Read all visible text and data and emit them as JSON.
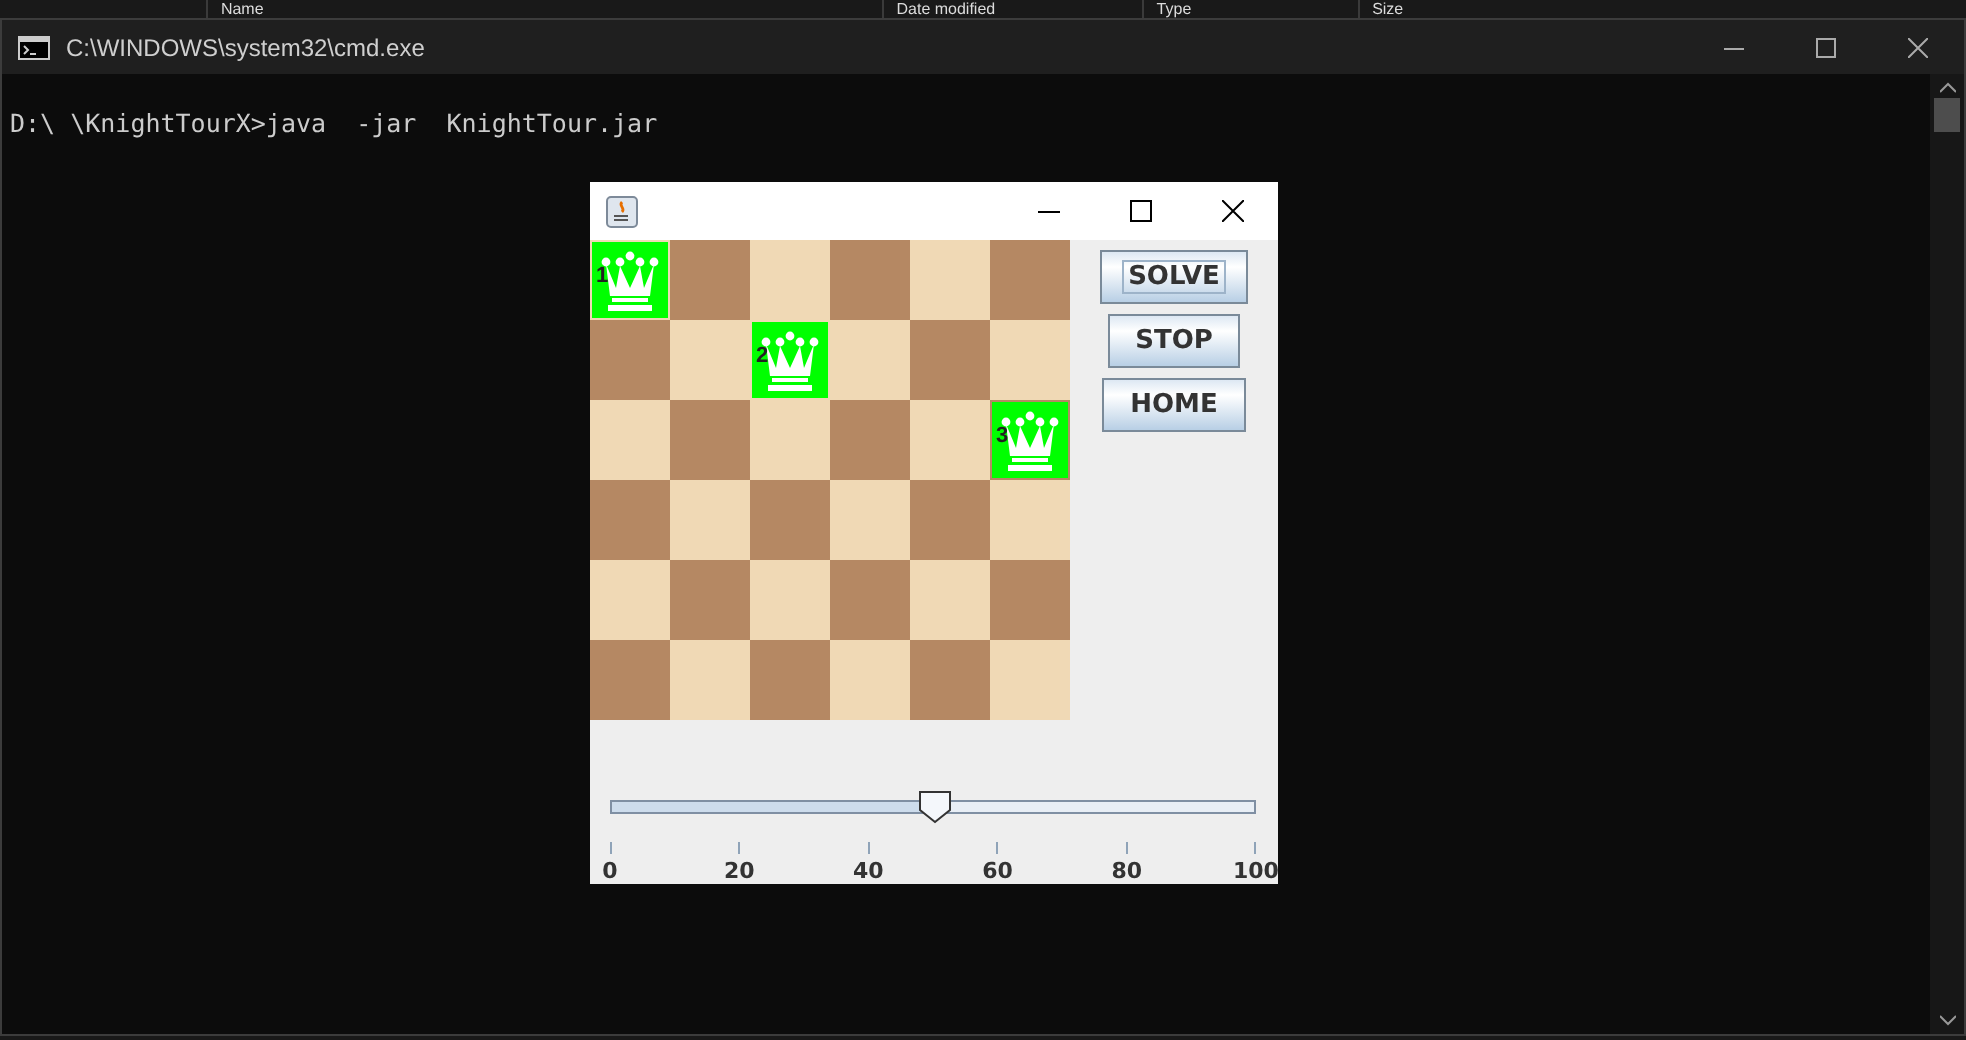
{
  "background_header": {
    "columns": [
      "Name",
      "Date modified",
      "Type",
      "Size"
    ]
  },
  "console_window": {
    "title": "C:\\WINDOWS\\system32\\cmd.exe",
    "lines": [
      "D:\\ \\KnightTourX>java  -jar  KnightTour.jar"
    ]
  },
  "app_window": {
    "board": [
      [
        {
          "kind": "light",
          "highlighted": true,
          "queen": "1"
        },
        {
          "kind": "dark",
          "highlighted": false
        },
        {
          "kind": "light",
          "highlighted": false
        },
        {
          "kind": "dark",
          "highlighted": false
        },
        {
          "kind": "light",
          "highlighted": false
        },
        {
          "kind": "dark",
          "highlighted": false
        }
      ],
      [
        {
          "kind": "dark",
          "highlighted": false
        },
        {
          "kind": "light",
          "highlighted": false
        },
        {
          "kind": "light",
          "highlighted": true,
          "queen": "2"
        },
        {
          "kind": "light",
          "highlighted": false
        },
        {
          "kind": "dark",
          "highlighted": false
        },
        {
          "kind": "light",
          "highlighted": false
        }
      ],
      [
        {
          "kind": "light",
          "highlighted": false
        },
        {
          "kind": "dark",
          "highlighted": false
        },
        {
          "kind": "light",
          "highlighted": false
        },
        {
          "kind": "dark",
          "highlighted": false
        },
        {
          "kind": "light",
          "highlighted": false
        },
        {
          "kind": "dark",
          "highlighted": true,
          "queen": "3"
        }
      ],
      [
        {
          "kind": "dark",
          "highlighted": false
        },
        {
          "kind": "light",
          "highlighted": false
        },
        {
          "kind": "dark",
          "highlighted": false
        },
        {
          "kind": "light",
          "highlighted": false
        },
        {
          "kind": "dark",
          "highlighted": false
        },
        {
          "kind": "light",
          "highlighted": false
        }
      ],
      [
        {
          "kind": "light",
          "highlighted": false
        },
        {
          "kind": "dark",
          "highlighted": false
        },
        {
          "kind": "light",
          "highlighted": false
        },
        {
          "kind": "dark",
          "highlighted": false
        },
        {
          "kind": "light",
          "highlighted": false
        },
        {
          "kind": "dark",
          "highlighted": false
        }
      ],
      [
        {
          "kind": "dark",
          "highlighted": false
        },
        {
          "kind": "light",
          "highlighted": false
        },
        {
          "kind": "dark",
          "highlighted": false
        },
        {
          "kind": "light",
          "highlighted": false
        },
        {
          "kind": "dark",
          "highlighted": false
        },
        {
          "kind": "light",
          "highlighted": false
        }
      ]
    ],
    "buttons": [
      {
        "label": "SOLVE",
        "focused": true
      },
      {
        "label": "STOP",
        "focused": false
      },
      {
        "label": "HOME",
        "focused": false
      }
    ],
    "slider": {
      "level": 0.5,
      "tick_labels": [
        "0",
        "20",
        "40",
        "60",
        "80",
        "100"
      ]
    }
  }
}
